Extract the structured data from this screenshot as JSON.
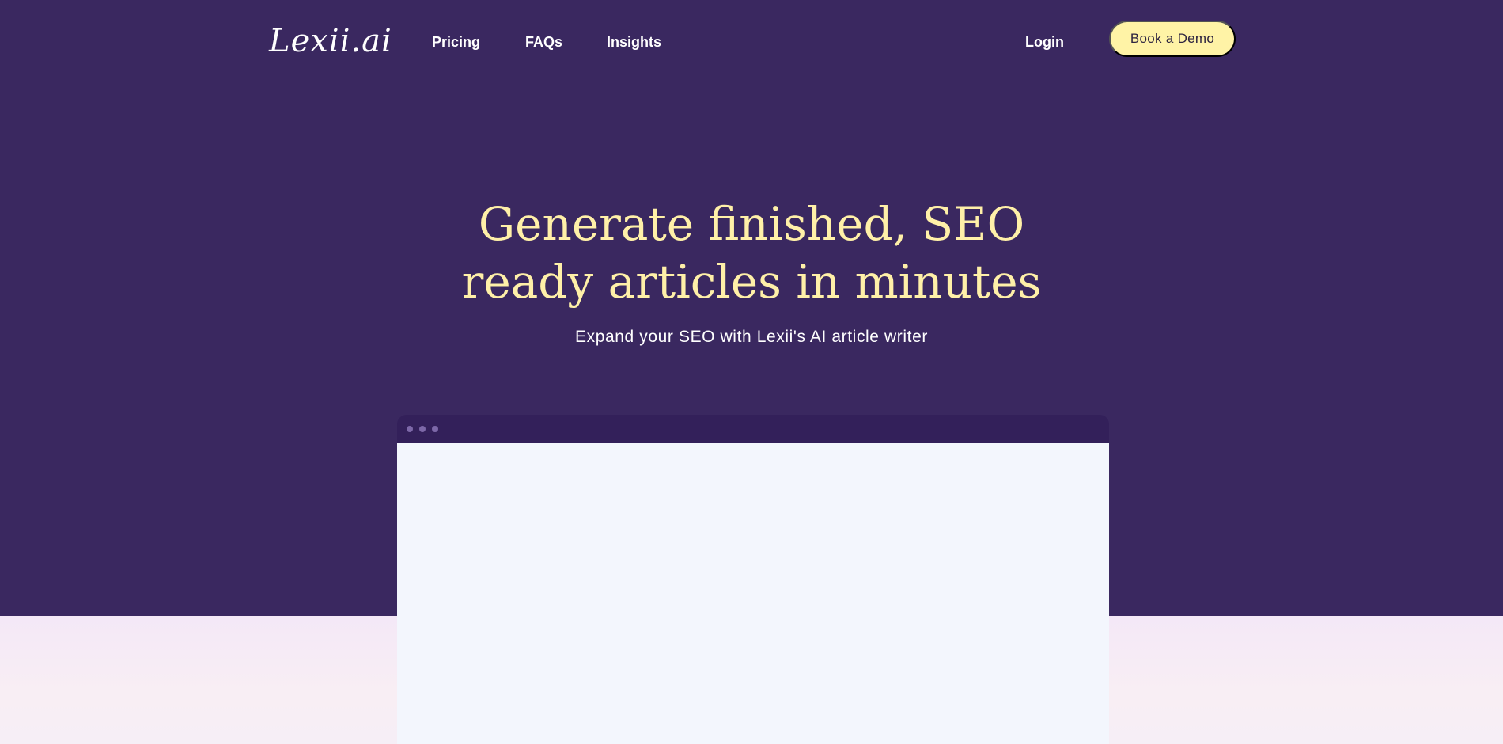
{
  "brand": {
    "logo_text": "Lexii.ai"
  },
  "nav": {
    "links": [
      {
        "label": "Pricing"
      },
      {
        "label": "FAQs"
      },
      {
        "label": "Insights"
      }
    ],
    "login_label": "Login",
    "cta_label": "Book a Demo"
  },
  "hero": {
    "headline_line1": "Generate finished, SEO",
    "headline_line2": "ready articles in minutes",
    "subheadline": "Expand your SEO with Lexii's AI article writer"
  },
  "colors": {
    "hero_background": "#3a2860",
    "headline": "#fff0a8",
    "cta_background": "#fff3a6",
    "browser_bar": "#33205a",
    "browser_body": "#f3f6fd"
  }
}
